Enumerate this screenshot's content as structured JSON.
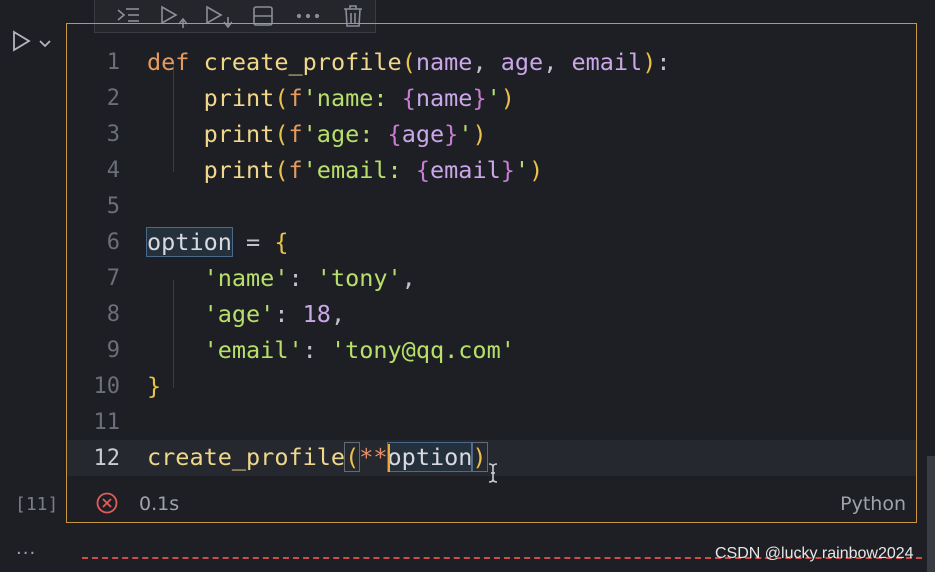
{
  "toolbar": {
    "buttons": [
      {
        "name": "run-by-line-icon"
      },
      {
        "name": "run-above-icon"
      },
      {
        "name": "run-below-icon"
      },
      {
        "name": "split-cell-icon"
      },
      {
        "name": "more-actions-icon"
      },
      {
        "name": "delete-cell-icon"
      }
    ]
  },
  "cell": {
    "execution_count": "[11]",
    "exec_time": "0.1s",
    "language": "Python",
    "line_numbers": [
      "1",
      "2",
      "3",
      "4",
      "5",
      "6",
      "7",
      "8",
      "9",
      "10",
      "11",
      "12"
    ]
  },
  "code": {
    "l1": {
      "kw": "def",
      "fn": "create_profile",
      "p1": "name",
      "p2": "age",
      "p3": "email"
    },
    "l2": {
      "fn": "print",
      "pre": "f",
      "s1": "'name: ",
      "v": "name",
      "s2": "'"
    },
    "l3": {
      "fn": "print",
      "pre": "f",
      "s1": "'age: ",
      "v": "age",
      "s2": "'"
    },
    "l4": {
      "fn": "print",
      "pre": "f",
      "s1": "'email: ",
      "v": "email",
      "s2": "'"
    },
    "l6": {
      "var": "option",
      "eq": " = "
    },
    "l7": {
      "key": "'name'",
      "val": "'tony'"
    },
    "l8": {
      "key": "'age'",
      "val": "18"
    },
    "l9": {
      "key": "'email'",
      "val": "'tony@qq.com'"
    },
    "l12": {
      "fn": "create_profile",
      "op": "**",
      "arg": "option"
    }
  },
  "footer": {
    "more": "···",
    "watermark": "CSDN @lucky rainbow2024"
  },
  "colors": {
    "cell_border": "#c8963e",
    "error": "#e35c5c",
    "keyword": "#e59b5f",
    "string": "#b7e06a"
  }
}
